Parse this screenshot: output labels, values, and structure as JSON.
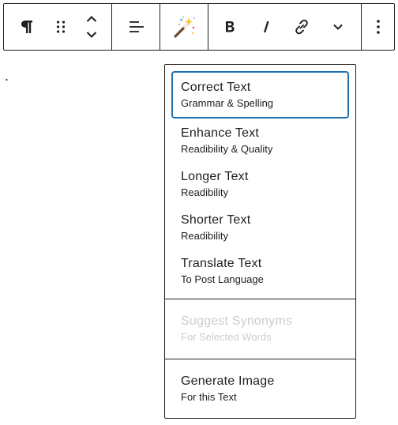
{
  "toolbar": {
    "block_type_icon": "paragraph-icon",
    "drag_icon": "drag-handle-icon",
    "move_up_icon": "chevron-up-icon",
    "move_down_icon": "chevron-down-icon",
    "align_icon": "align-left-icon",
    "ai_icon": "magic-wand-icon",
    "bold_icon": "bold-icon",
    "italic_icon": "italic-icon",
    "link_icon": "link-icon",
    "more_format_icon": "chevron-down-icon",
    "options_icon": "vertical-ellipsis-icon"
  },
  "editor": {
    "paragraph_text": "."
  },
  "menu": {
    "sections": [
      {
        "items": [
          {
            "title": "Correct Text",
            "subtitle": "Grammar & Spelling",
            "focused": true,
            "disabled": false
          },
          {
            "title": "Enhance Text",
            "subtitle": "Readibility & Quality",
            "focused": false,
            "disabled": false
          },
          {
            "title": "Longer Text",
            "subtitle": "Readibility",
            "focused": false,
            "disabled": false
          },
          {
            "title": "Shorter Text",
            "subtitle": "Readibility",
            "focused": false,
            "disabled": false
          },
          {
            "title": "Translate Text",
            "subtitle": "To Post Language",
            "focused": false,
            "disabled": false
          }
        ]
      },
      {
        "items": [
          {
            "title": "Suggest Synonyms",
            "subtitle": "For Selected Words",
            "focused": false,
            "disabled": true
          }
        ]
      },
      {
        "items": [
          {
            "title": "Generate Image",
            "subtitle": "For this Text",
            "focused": false,
            "disabled": false
          }
        ]
      }
    ]
  },
  "colors": {
    "text": "#1e1e1e",
    "border": "#1e1e1e",
    "focus_ring": "#2271b1",
    "disabled_text": "#cccccc"
  }
}
